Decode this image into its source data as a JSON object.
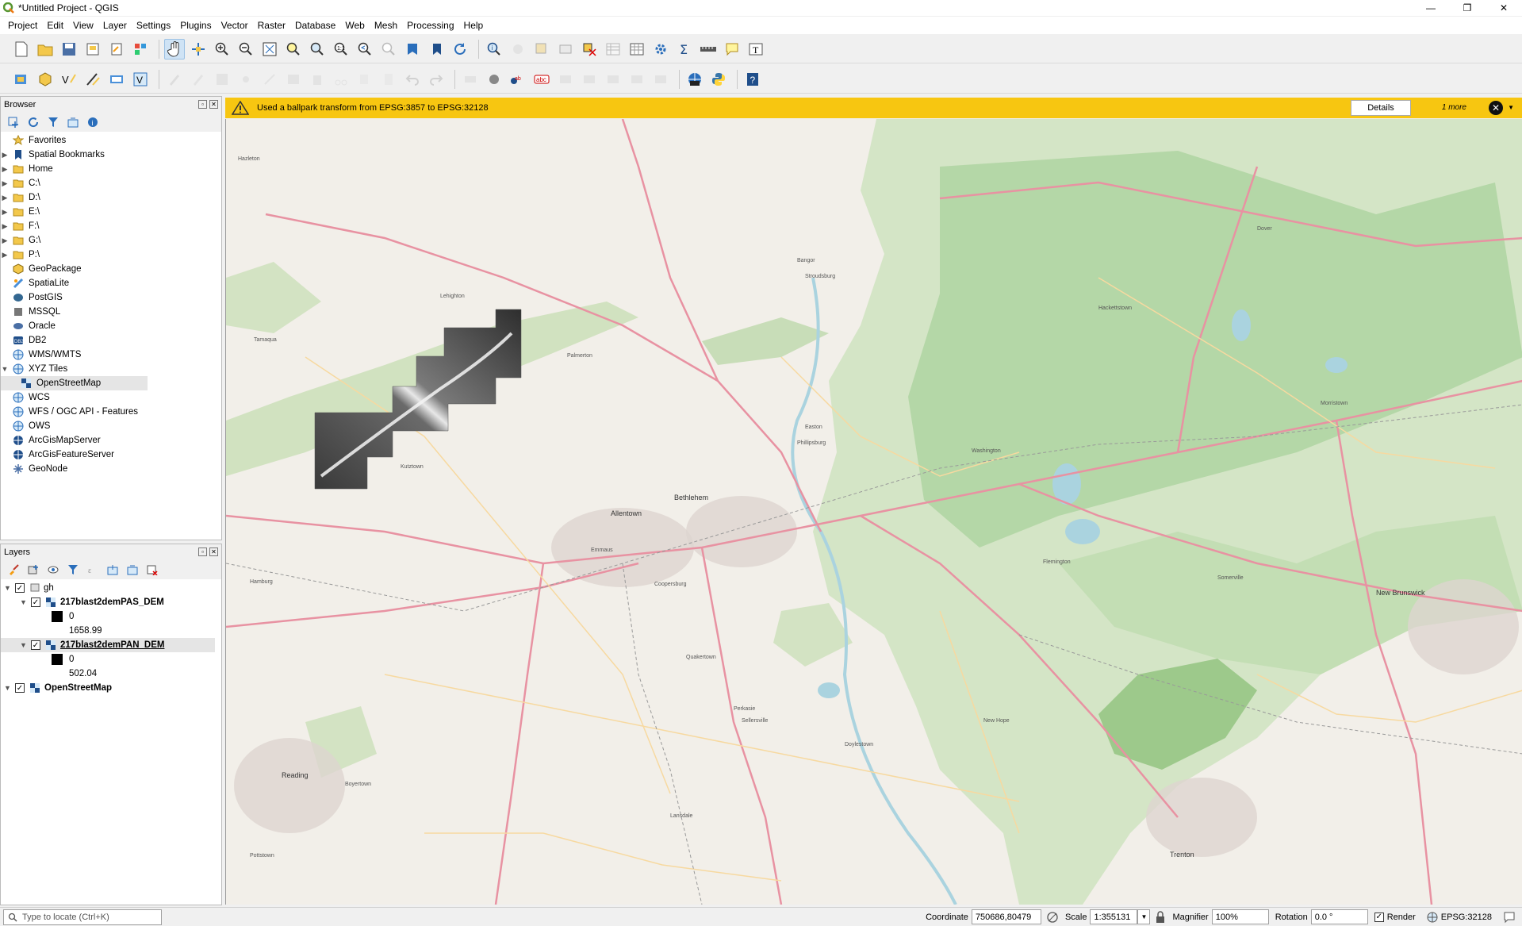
{
  "window": {
    "title": "*Untitled Project - QGIS",
    "minimize": "—",
    "maximize": "❐",
    "close": "✕"
  },
  "menu": [
    "Project",
    "Edit",
    "View",
    "Layer",
    "Settings",
    "Plugins",
    "Vector",
    "Raster",
    "Database",
    "Web",
    "Mesh",
    "Processing",
    "Help"
  ],
  "browser": {
    "title": "Browser",
    "items": [
      {
        "label": "Favorites",
        "icon": "star-icon",
        "arrow": ""
      },
      {
        "label": "Spatial Bookmarks",
        "icon": "bookmark-icon",
        "arrow": "▶"
      },
      {
        "label": "Home",
        "icon": "home-folder-icon",
        "arrow": "▶"
      },
      {
        "label": "C:\\",
        "icon": "drive-icon",
        "arrow": "▶"
      },
      {
        "label": "D:\\",
        "icon": "drive-icon",
        "arrow": "▶"
      },
      {
        "label": "E:\\",
        "icon": "drive-icon",
        "arrow": "▶"
      },
      {
        "label": "F:\\",
        "icon": "drive-icon",
        "arrow": "▶"
      },
      {
        "label": "G:\\",
        "icon": "drive-icon",
        "arrow": "▶"
      },
      {
        "label": "P:\\",
        "icon": "drive-icon",
        "arrow": "▶"
      },
      {
        "label": "GeoPackage",
        "icon": "geopackage-icon",
        "arrow": ""
      },
      {
        "label": "SpatiaLite",
        "icon": "spatialite-icon",
        "arrow": ""
      },
      {
        "label": "PostGIS",
        "icon": "postgis-icon",
        "arrow": ""
      },
      {
        "label": "MSSQL",
        "icon": "mssql-icon",
        "arrow": ""
      },
      {
        "label": "Oracle",
        "icon": "oracle-icon",
        "arrow": ""
      },
      {
        "label": "DB2",
        "icon": "db2-icon",
        "arrow": ""
      },
      {
        "label": "WMS/WMTS",
        "icon": "globe-icon",
        "arrow": ""
      },
      {
        "label": "XYZ Tiles",
        "icon": "globe-icon",
        "arrow": "▼"
      },
      {
        "label": "OpenStreetMap",
        "icon": "xyz-layer-icon",
        "arrow": "",
        "child": true
      },
      {
        "label": "WCS",
        "icon": "globe-icon",
        "arrow": ""
      },
      {
        "label": "WFS / OGC API - Features",
        "icon": "globe-icon",
        "arrow": ""
      },
      {
        "label": "OWS",
        "icon": "globe-icon",
        "arrow": ""
      },
      {
        "label": "ArcGisMapServer",
        "icon": "globe-icon",
        "arrow": ""
      },
      {
        "label": "ArcGisFeatureServer",
        "icon": "globe-icon",
        "arrow": ""
      },
      {
        "label": "GeoNode",
        "icon": "geonode-icon",
        "arrow": ""
      }
    ]
  },
  "layers": {
    "title": "Layers",
    "group": {
      "name": "gh",
      "checked": "✓"
    },
    "layer1": {
      "name": "217blast2demPAS_DEM",
      "min": "0",
      "max": "1658.99"
    },
    "layer2": {
      "name": "217blast2demPAN_DEM",
      "min": "0",
      "max": "502.04"
    },
    "layer3": {
      "name": "OpenStreetMap"
    },
    "check": "✓",
    "expanded": "▼"
  },
  "message": {
    "text": "Used a ballpark transform from EPSG:3857 to EPSG:32128",
    "details": "Details",
    "more": "1 more",
    "close": "✕",
    "dropdown": "▼"
  },
  "map_labels": [
    "Hazleton",
    "Tamaqua",
    "Lehighton",
    "Palmerton",
    "Bangor",
    "Stroudsburg",
    "Easton",
    "Allentown",
    "Bethlehem",
    "Emmaus",
    "Coopersburg",
    "Quakertown",
    "Sellersville",
    "Perkasie",
    "Doylestown",
    "Boyertown",
    "Reading",
    "New Hope",
    "Flemington",
    "Somerville",
    "Trenton",
    "New Brunswick",
    "Morristown",
    "Dover",
    "Hackettstown",
    "Washington",
    "Phillipsburg",
    "Lansdale",
    "Pottstown",
    "Kutztown",
    "Hamburg"
  ],
  "status": {
    "locator_placeholder": "Type to locate (Ctrl+K)",
    "coordinate_label": "Coordinate",
    "coordinate": "750686,80479",
    "scale_label": "Scale",
    "scale": "1:355131",
    "magnifier_label": "Magnifier",
    "magnifier": "100%",
    "rotation_label": "Rotation",
    "rotation": "0.0 °",
    "render_label": "Render",
    "crs": "EPSG:32128"
  },
  "colors": {
    "accent": "#f7c611",
    "map_bg": "#f2efe9",
    "forest": "#a9d19c",
    "road": "#e892a2",
    "water": "#aad3df"
  }
}
